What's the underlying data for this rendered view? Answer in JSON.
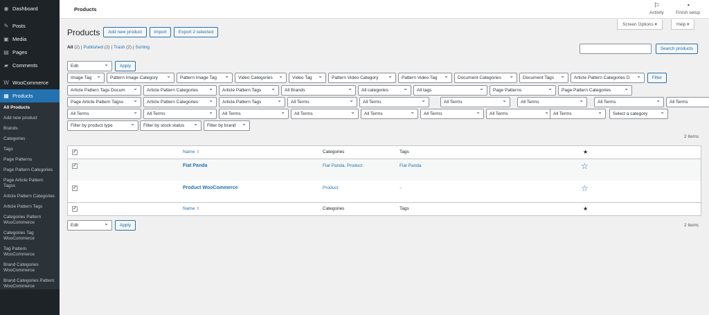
{
  "sidebar": {
    "items": [
      {
        "label": "Dashboard",
        "icon": "dashboard-icon",
        "glyph": "◉"
      },
      {
        "label": "Posts",
        "icon": "pin-icon",
        "glyph": "✎"
      },
      {
        "label": "Media",
        "icon": "media-icon",
        "glyph": "▣"
      },
      {
        "label": "Pages",
        "icon": "pages-icon",
        "glyph": "▤"
      },
      {
        "label": "Comments",
        "icon": "comments-icon",
        "glyph": "▰"
      },
      {
        "label": "WooCommerce",
        "icon": "woocommerce-icon",
        "glyph": "W"
      },
      {
        "label": "Products",
        "icon": "products-icon",
        "glyph": "▦"
      }
    ],
    "submenu": [
      "All Products",
      "Add new product",
      "Brands",
      "Categories",
      "Tags",
      "Page Patterns",
      "Page Pattern Categories",
      "Page Article Pattern Tagss",
      "Article Pattern Categories",
      "Article Pattern Tags",
      "Categories Pattern WooCommerce",
      "Categories Tag WooCommerce",
      "Tag Pattern WooCommerce",
      "Brand Categories WooCommerce",
      "Brand Categories Pattern WooCommerce"
    ]
  },
  "topbar": {
    "title": "Products",
    "activity": "Activity",
    "finish_setup": "Finish setup"
  },
  "screen_options": "Screen Options ▾",
  "help": "Help ▾",
  "page": {
    "heading": "Products",
    "add_new": "Add new product",
    "import": "Import",
    "export": "Export 2 selected"
  },
  "subsubsub": {
    "all": "All",
    "all_count": "(2)",
    "published": "Published",
    "published_count": "(2)",
    "trash": "Trash",
    "trash_count": "(2)",
    "sorting": "Sorting",
    "sep": "|"
  },
  "search_button": "Search products",
  "bulk_action": "Edit",
  "apply": "Apply",
  "filter": "Filter",
  "filters_row1": [
    "Image Tag",
    "Pattern Image Category",
    "Pattern Image Tag",
    "Video Categories",
    "Video Tag",
    "Pattern Video Category",
    "Pattern Video Tag",
    "Document Categories",
    "Document Tags",
    "Article Pattern Categories D"
  ],
  "filters_row2": [
    "Article Pattern Tags Docum",
    "Article Pattern Categories",
    "Article Pattern Tags",
    "All Brands",
    "All categories",
    "All tags",
    "Page Patterns",
    "Page Pattern Categories"
  ],
  "filters_row3": [
    "Page Article Pattern Tagss",
    "Article Pattern Categories",
    "Article Pattern Tags",
    "All Terms",
    "All Terms",
    "All Terms",
    "All Terms",
    "All Terms",
    "All Terms"
  ],
  "filters_row4": [
    "All Terms",
    "All Terms",
    "All Terms",
    "All Terms",
    "All Terms",
    "All Terms",
    "All Terms",
    "All Terms",
    "Select a category"
  ],
  "filters_row5": [
    "Filter by product type",
    "Filter by stock status",
    "Filter by brand"
  ],
  "items_count": "2 items",
  "table": {
    "col_name": "Name",
    "col_categories": "Categories",
    "col_tags": "Tags",
    "col_featured": "★",
    "sort_glyph": "⇕",
    "check": "✓",
    "rows": [
      {
        "name": "Fiat Panda",
        "categories": "Fiat Panda, Product",
        "tags": "Fiat Panda",
        "featured": "☆"
      },
      {
        "name": "Product WooCommerce",
        "categories": "Product",
        "tags": "–",
        "featured": "☆"
      }
    ]
  }
}
